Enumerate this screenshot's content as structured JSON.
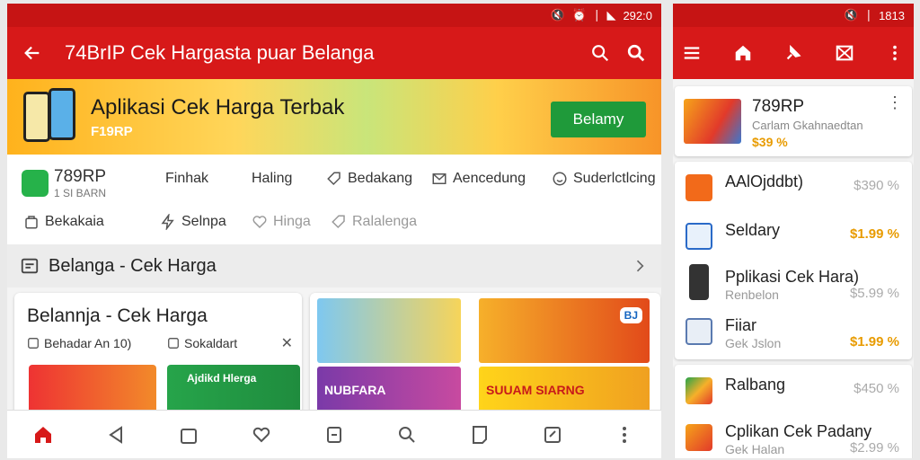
{
  "left_status": {
    "time": "292:0"
  },
  "left_appbar": {
    "title": "74BrIP Cek Hargasta puar Belanga"
  },
  "banner": {
    "title": "Aplikasi Cek Harga Terbak",
    "subtitle": "F19RP",
    "cta": "Belamy"
  },
  "categories": [
    {
      "label": "789RP",
      "sub": "1 SI BARN"
    },
    {
      "label": "Finhak"
    },
    {
      "label": "Haling"
    },
    {
      "label": "Bedakang"
    },
    {
      "label": "Aencedung"
    },
    {
      "label": "Suderlctlcing"
    },
    {
      "label": "Bekakaia"
    },
    {
      "label": "Selnpa"
    },
    {
      "label": "Hinga"
    },
    {
      "label": "Ralalenga"
    }
  ],
  "section": {
    "title": "Belanga - Cek Harga"
  },
  "card1": {
    "title": "Belannja - Cek Harga",
    "chip1": "Behadar An 10)",
    "chip2": "Sokaldart",
    "promo1": "",
    "promo2": "Ajdikd Hlerga"
  },
  "tiles": [
    {
      "label": "",
      "badge": ""
    },
    {
      "label": "",
      "badge": "BJ"
    },
    {
      "label": "NUBFARA",
      "badge": ""
    },
    {
      "label": "SUUAM SIARNG",
      "badge": ""
    }
  ],
  "right_status": {
    "time": "1813"
  },
  "right_card": {
    "name": "789RP",
    "sub": "Carlam Gkahnaedtan",
    "price": "$39 %"
  },
  "right_items": [
    {
      "name": "AAlOjddbt)",
      "sub": "",
      "price": "$390 %",
      "gold": false
    },
    {
      "name": "Seldary",
      "sub": "",
      "price": "$1.99 %",
      "gold": true
    },
    {
      "name": "Pplikasi Cek Hara)",
      "sub": "Renbelon",
      "price": "$5.99 %",
      "gold": false
    },
    {
      "name": "Fiiar",
      "sub": "Gek Jslon",
      "price": "$1.99 %",
      "gold": true
    },
    {
      "name": "Ralbang",
      "sub": "",
      "price": "$450 %",
      "gold": false
    },
    {
      "name": "Cplikan Cek Padany",
      "sub": "Gek Halan",
      "price": "$2.99 %",
      "gold": false
    }
  ],
  "colors": {
    "primary": "#d71919",
    "cta": "#1f9a3a",
    "price_gold": "#e89b00"
  }
}
